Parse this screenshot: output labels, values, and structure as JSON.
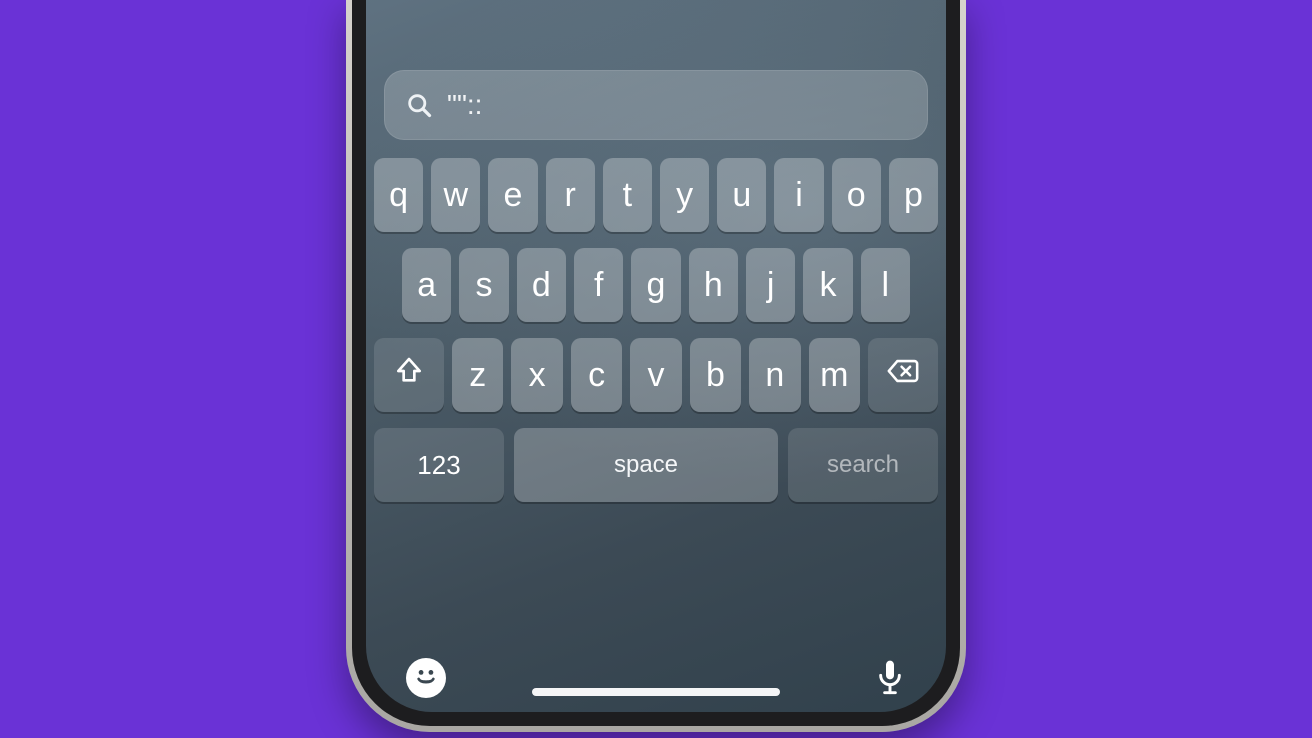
{
  "search": {
    "value": "\"\"::"
  },
  "keyboard": {
    "row1": [
      "q",
      "w",
      "e",
      "r",
      "t",
      "y",
      "u",
      "i",
      "o",
      "p"
    ],
    "row2": [
      "a",
      "s",
      "d",
      "f",
      "g",
      "h",
      "j",
      "k",
      "l"
    ],
    "row3": [
      "z",
      "x",
      "c",
      "v",
      "b",
      "n",
      "m"
    ],
    "numbers_label": "123",
    "space_label": "space",
    "action_label": "search"
  }
}
